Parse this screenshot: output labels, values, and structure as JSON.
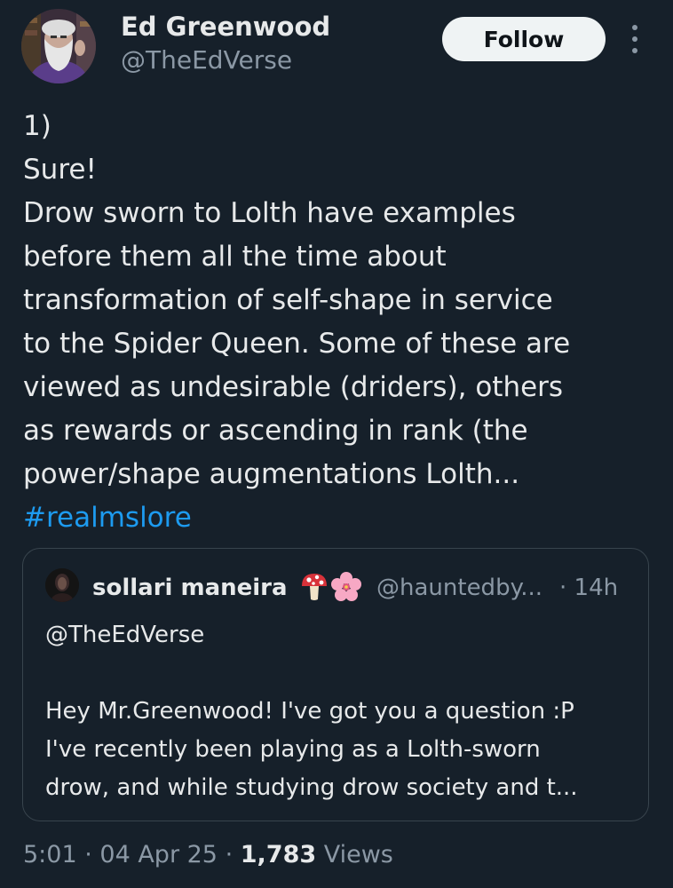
{
  "author": {
    "name": "Ed Greenwood",
    "handle": "@TheEdVerse",
    "follow_label": "Follow"
  },
  "tweet": {
    "lines": [
      "1)",
      "Sure!",
      "Drow sworn to Lolth have examples",
      "before them all the time about",
      "transformation of self-shape in service",
      "to the Spider Queen. Some of these are",
      "viewed as undesirable (driders), others",
      "as rewards or ascending in rank (the",
      "power/shape augmentations Lolth..."
    ],
    "hashtag": "#realmslore"
  },
  "quoted_tweet": {
    "name": "sollari maneira",
    "emoji_1": "🍄",
    "emoji_2": "🌸",
    "handle": "@hauntedby...",
    "time": "· 14h",
    "reply_to": "@TheEdVerse",
    "lines": [
      "Hey Mr.Greenwood! I've got you a question :P",
      "I've recently been playing as a Lolth-sworn",
      "drow, and while studying drow society and t..."
    ]
  },
  "meta": {
    "time": "5:01",
    "sep1": " · ",
    "date": "04 Apr 25",
    "sep2": " · ",
    "views_count": "1,783",
    "views_label": " Views"
  },
  "colors": {
    "background": "#16202a",
    "text_primary": "#e7e9ea",
    "text_secondary": "#8b98a5",
    "link": "#1d9bf0",
    "border": "#38444d",
    "follow_bg": "#eff3f4"
  },
  "icons": {
    "more": "more-vertical-icon"
  }
}
